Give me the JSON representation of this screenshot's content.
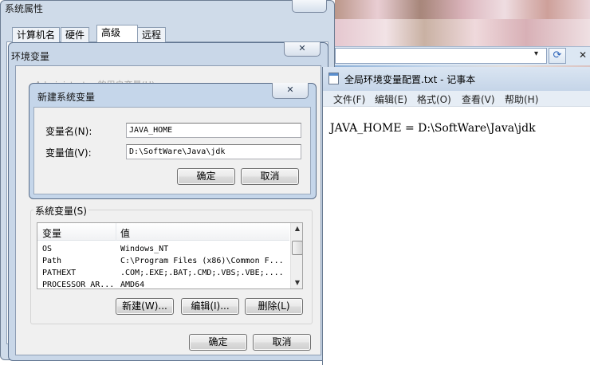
{
  "system_properties": {
    "title": "系统属性",
    "tabs": [
      "计算机名",
      "硬件",
      "高级",
      "远程"
    ],
    "active_tab": "高级"
  },
  "env_dialog": {
    "title": "环境变量",
    "close_glyph": "✕",
    "user_vars_label_partial": "Administrator 的用户变量(U)",
    "sys_vars_label": "系统变量(S)",
    "columns": [
      "变量",
      "值"
    ],
    "rows": [
      {
        "name": "OS",
        "value": "Windows_NT"
      },
      {
        "name": "Path",
        "value": "C:\\Program Files (x86)\\Common F..."
      },
      {
        "name": "PATHEXT",
        "value": ".COM;.EXE;.BAT;.CMD;.VBS;.VBE;...."
      },
      {
        "name": "PROCESSOR_AR...",
        "value": "AMD64"
      }
    ],
    "buttons": {
      "new": "新建(W)...",
      "edit": "编辑(I)...",
      "delete": "删除(L)",
      "ok": "确定",
      "cancel": "取消"
    }
  },
  "new_var_dialog": {
    "title": "新建系统变量",
    "close_glyph": "✕",
    "name_label": "变量名(N):",
    "value_label": "变量值(V):",
    "name_value": "JAVA_HOME",
    "value_value": "D:\\SoftWare\\Java\\jdk",
    "ok": "确定",
    "cancel": "取消"
  },
  "notepad": {
    "title": "全局环境变量配置.txt - 记事本",
    "menu": [
      "文件(F)",
      "编辑(E)",
      "格式(O)",
      "查看(V)",
      "帮助(H)"
    ],
    "content": "JAVA_HOME = D:\\SoftWare\\Java\\jdk"
  },
  "browser": {
    "dropdown_glyph": "▾",
    "refresh_glyph": "⟳",
    "stop_glyph": "✕"
  }
}
